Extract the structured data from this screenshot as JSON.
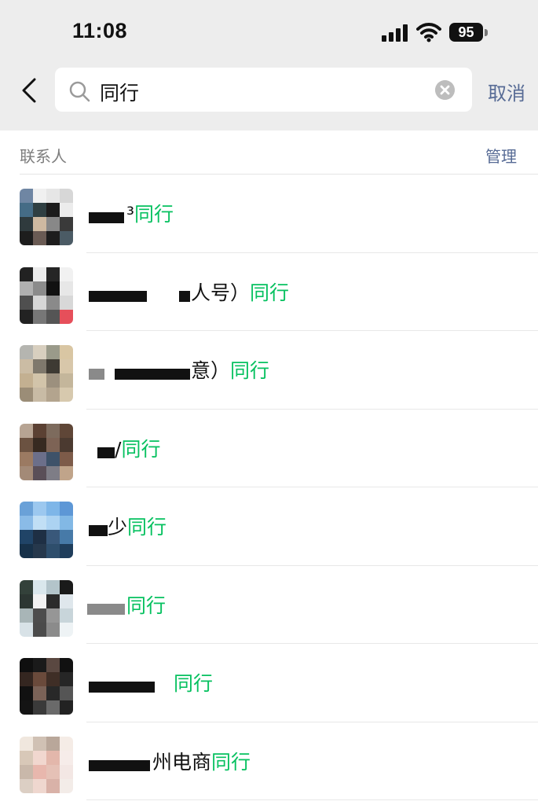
{
  "status_bar": {
    "time": "11:08",
    "battery": "95"
  },
  "search": {
    "query": "同行",
    "cancel_label": "取消"
  },
  "section": {
    "title": "联系人",
    "action": "管理"
  },
  "contacts": [
    {
      "name_prefix": "³",
      "keyword": "同行"
    },
    {
      "name_prefix": "人号）",
      "keyword": "同行"
    },
    {
      "name_prefix": "意）",
      "keyword": "同行"
    },
    {
      "name_prefix": "/",
      "keyword": "同行"
    },
    {
      "name_prefix": "少",
      "keyword": "同行"
    },
    {
      "name_prefix": "",
      "keyword": "同行"
    },
    {
      "name_prefix": "",
      "keyword": "同行"
    },
    {
      "name_prefix": "州电商",
      "keyword": "同行"
    }
  ],
  "colors": {
    "highlight": "#07c160",
    "link": "#576b95"
  }
}
